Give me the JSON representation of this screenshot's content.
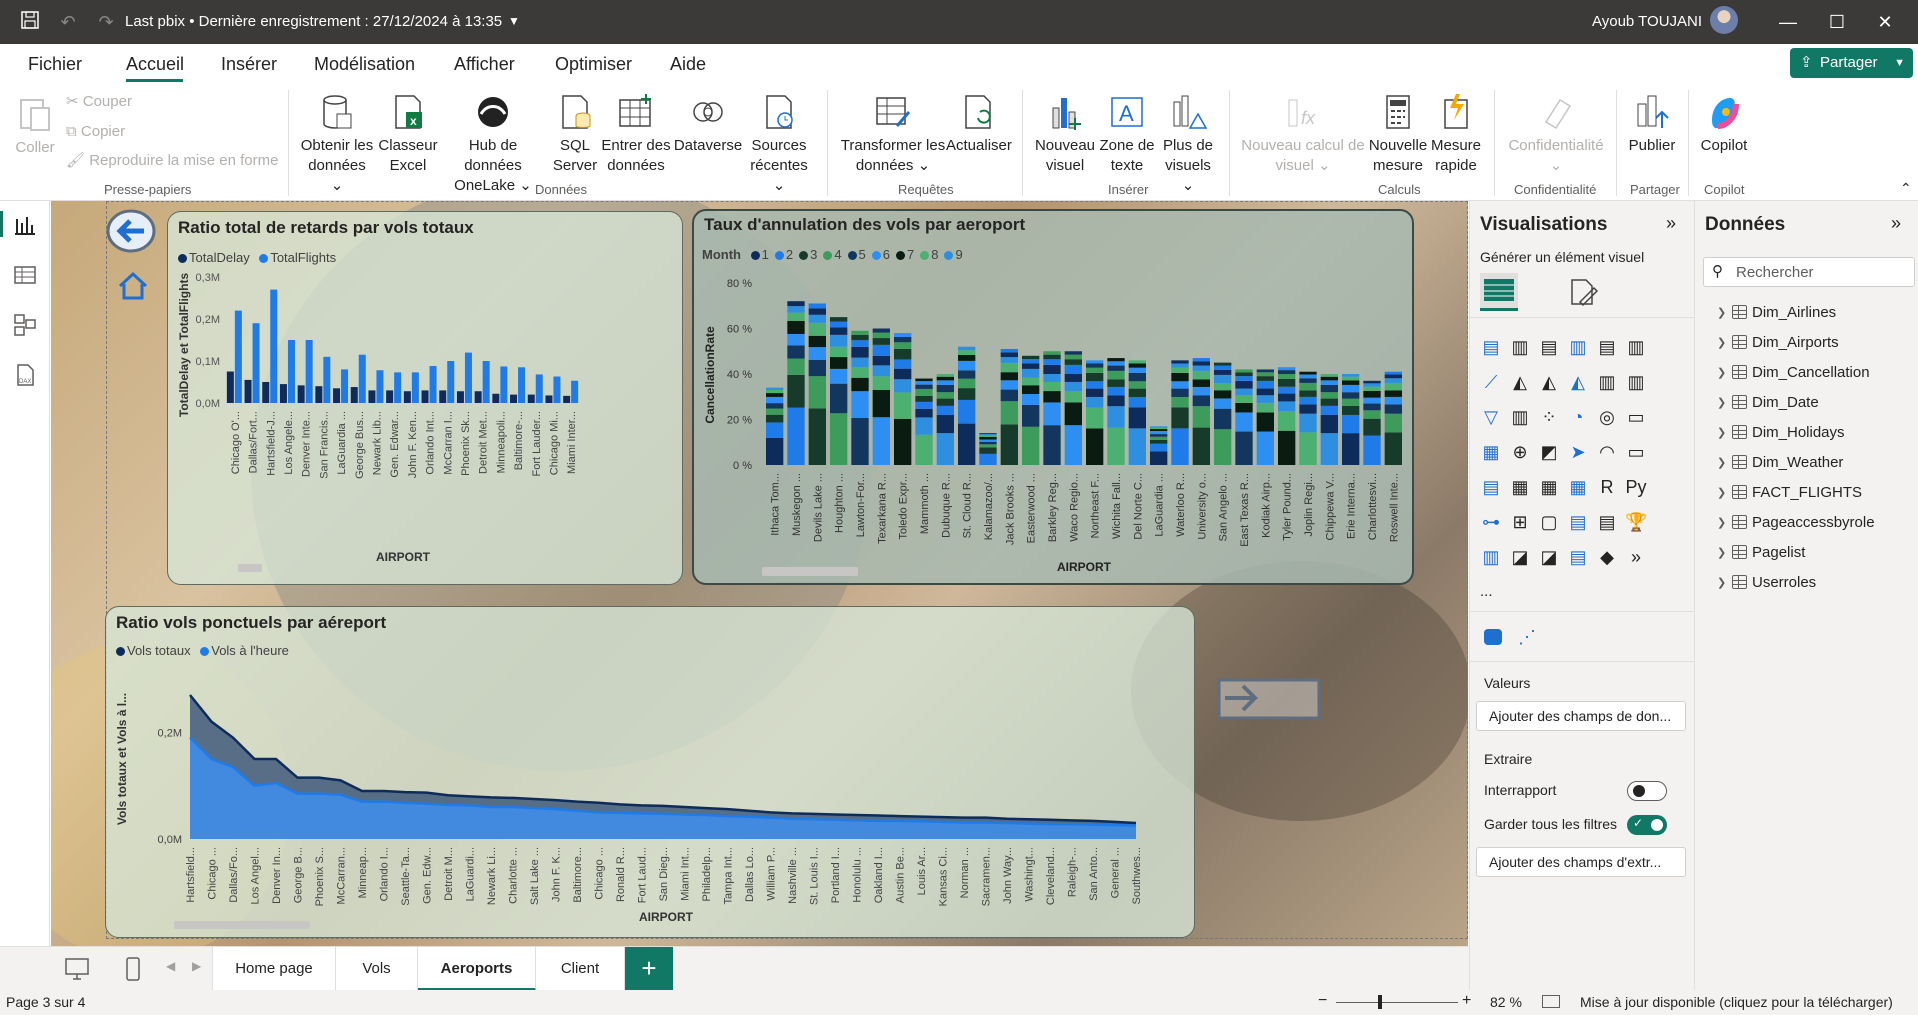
{
  "titlebar": {
    "title": "Last pbix • Dernière enregistrement : 27/12/2024 à 13:35",
    "user": "Ayoub TOUJANI"
  },
  "menu": [
    "Fichier",
    "Accueil",
    "Insérer",
    "Modélisation",
    "Afficher",
    "Optimiser",
    "Aide"
  ],
  "share_label": "Partager",
  "ribbon": {
    "clipboard": {
      "paste": "Coller",
      "cut": "Couper",
      "copy": "Copier",
      "format": "Reproduire la mise en forme",
      "group": "Presse-papiers"
    },
    "data": {
      "get": [
        "Obtenir les",
        "données"
      ],
      "excel": [
        "Classeur",
        "Excel"
      ],
      "onelake": [
        "Hub de données",
        "OneLake"
      ],
      "sql": [
        "SQL",
        "Server"
      ],
      "enter": [
        "Entrer des",
        "données"
      ],
      "dataverse": "Dataverse",
      "recent": [
        "Sources",
        "récentes"
      ],
      "group": "Données"
    },
    "queries": {
      "transform": [
        "Transformer les",
        "données"
      ],
      "refresh": "Actualiser",
      "group": "Requêtes"
    },
    "insert": {
      "visual": [
        "Nouveau",
        "visuel"
      ],
      "textbox": [
        "Zone de",
        "texte"
      ],
      "more": [
        "Plus de",
        "visuels"
      ],
      "group": "Insérer"
    },
    "calc": {
      "newcalc": [
        "Nouveau calcul de",
        "visuel"
      ],
      "measure": [
        "Nouvelle",
        "mesure"
      ],
      "quick": [
        "Mesure",
        "rapide"
      ],
      "group": "Calculs"
    },
    "sensitivity": {
      "label": "Confidentialité",
      "group": "Confidentialité"
    },
    "share": {
      "publish": "Publier",
      "group": "Partager"
    },
    "copilot": {
      "label": "Copilot",
      "group": "Copilot"
    }
  },
  "visuals": {
    "v1": {
      "title": "Ratio total de retards par vols totaux",
      "legend": [
        "TotalDelay",
        "TotalFlights"
      ],
      "ylabel": "TotalDelay et TotalFlights",
      "xlabel": "AIRPORT"
    },
    "v2": {
      "title": "Taux d'annulation des vols par aeroport",
      "legend_title": "Month",
      "legend": [
        "1",
        "2",
        "3",
        "4",
        "5",
        "6",
        "7",
        "8",
        "9"
      ],
      "ylabel": "CancellationRate",
      "xlabel": "AIRPORT"
    },
    "v3": {
      "title": "Ratio vols ponctuels par aéreport",
      "legend": [
        "Vols totaux",
        "Vols à l'heure"
      ],
      "ylabel": "Vols totaux et Vols à l...",
      "xlabel": "AIRPORT"
    }
  },
  "chart_data": [
    {
      "type": "bar",
      "title": "Ratio total de retards par vols totaux",
      "xlabel": "AIRPORT",
      "ylabel": "TotalDelay et TotalFlights",
      "yticks": [
        "0,0M",
        "0,1M",
        "0,2M",
        "0,3M"
      ],
      "ylim": [
        0,
        0.3
      ],
      "categories": [
        "Chicago O'...",
        "Dallas/Fort...",
        "Hartsfield-J...",
        "Los Angele...",
        "Denver Inte...",
        "San Francis...",
        "LaGuardia ...",
        "George Bus...",
        "Newark Lib...",
        "Gen. Edwar...",
        "John F. Ken...",
        "Orlando Int...",
        "McCarran I...",
        "Phoenix Sk...",
        "Detroit Met...",
        "Minneapoli...",
        "Baltimore-...",
        "Fort Lauder...",
        "Chicago Mi...",
        "Miami Inter..."
      ],
      "series": [
        {
          "name": "TotalDelay",
          "values": [
            0.075,
            0.055,
            0.05,
            0.045,
            0.042,
            0.04,
            0.035,
            0.038,
            0.03,
            0.03,
            0.028,
            0.03,
            0.03,
            0.028,
            0.028,
            0.022,
            0.02,
            0.02,
            0.018,
            0.017
          ]
        },
        {
          "name": "TotalFlights",
          "values": [
            0.22,
            0.19,
            0.27,
            0.15,
            0.15,
            0.11,
            0.08,
            0.115,
            0.078,
            0.073,
            0.073,
            0.088,
            0.1,
            0.12,
            0.1,
            0.087,
            0.085,
            0.068,
            0.063,
            0.053
          ]
        }
      ]
    },
    {
      "type": "bar",
      "title": "Taux d'annulation des vols par aeroport",
      "xlabel": "AIRPORT",
      "ylabel": "CancellationRate",
      "yticks": [
        "0 %",
        "20 %",
        "40 %",
        "60 %",
        "80 %"
      ],
      "ylim": [
        0,
        80
      ],
      "categories": [
        "Ithaca Tom...",
        "Muskegon ...",
        "Devils Lake ...",
        "Houghton ...",
        "Lawton-For...",
        "Texarkana R...",
        "Toledo Expr...",
        "Mammoth ...",
        "Dubuque R...",
        "St. Cloud R...",
        "Kalamazoo/...",
        "Jack Brooks ...",
        "Easterwood ...",
        "Barkley Reg...",
        "Waco Regio...",
        "Northeast F...",
        "Wichita Fall...",
        "Del Norte C...",
        "LaGuardia ...",
        "Waterloo R...",
        "University o...",
        "San Angelo ...",
        "East Texas R...",
        "Kodiak Airp...",
        "Tyler Pound...",
        "Joplin Regi...",
        "Chippewa V...",
        "Erie Interna...",
        "Charlottesvi...",
        "Roswell Inte..."
      ],
      "totals": [
        34,
        72,
        71,
        65,
        59,
        60,
        58,
        38,
        40,
        52,
        14,
        51,
        48,
        50,
        50,
        46,
        47,
        46,
        17,
        46,
        47,
        45,
        42,
        42,
        43,
        41,
        40,
        40,
        37,
        41
      ]
    },
    {
      "type": "area",
      "title": "Ratio vols ponctuels par aéreport",
      "xlabel": "AIRPORT",
      "ylabel": "Vols totaux et Vols à l...",
      "yticks": [
        "0,0M",
        "0,2M"
      ],
      "categories": [
        "Hartsfield...",
        "Chicago ...",
        "Dallas/Fo...",
        "Los Angel...",
        "Denver In...",
        "George B...",
        "Phoenix S...",
        "McCarran...",
        "Minneap...",
        "Orlando I...",
        "Seattle-Ta...",
        "Gen. Edw...",
        "Detroit M...",
        "LaGuardi...",
        "Newark Li...",
        "Charlotte ...",
        "Salt Lake ...",
        "John F. K...",
        "Baltimore...",
        "Chicago ...",
        "Ronald R...",
        "Fort Laud...",
        "San Dieg...",
        "Miami Int...",
        "Philadelp...",
        "Tampa Int...",
        "Dallas Lo...",
        "William P...",
        "Nashville ...",
        "St. Louis I...",
        "Portland I...",
        "Honolulu ...",
        "Oakland I...",
        "Austin Be...",
        "Louis Ar...",
        "Kansas Ci...",
        "Norman ...",
        "Sacramen...",
        "John Way...",
        "Washingt...",
        "Cleveland...",
        "Raleigh-...",
        "San Anto...",
        "General ...",
        "Southwes..."
      ],
      "series": [
        {
          "name": "Vols totaux",
          "values": [
            0.27,
            0.22,
            0.19,
            0.15,
            0.15,
            0.115,
            0.115,
            0.11,
            0.09,
            0.09,
            0.088,
            0.087,
            0.082,
            0.08,
            0.078,
            0.077,
            0.075,
            0.073,
            0.07,
            0.068,
            0.065,
            0.063,
            0.062,
            0.06,
            0.058,
            0.056,
            0.053,
            0.05,
            0.048,
            0.047,
            0.046,
            0.045,
            0.044,
            0.043,
            0.042,
            0.041,
            0.04,
            0.04,
            0.038,
            0.037,
            0.036,
            0.035,
            0.034,
            0.032,
            0.03
          ]
        },
        {
          "name": "Vols à l'heure",
          "values": [
            0.19,
            0.15,
            0.135,
            0.1,
            0.105,
            0.085,
            0.085,
            0.083,
            0.07,
            0.07,
            0.068,
            0.066,
            0.064,
            0.063,
            0.06,
            0.06,
            0.058,
            0.056,
            0.053,
            0.05,
            0.049,
            0.048,
            0.047,
            0.046,
            0.045,
            0.043,
            0.042,
            0.04,
            0.038,
            0.037,
            0.036,
            0.035,
            0.034,
            0.034,
            0.033,
            0.032,
            0.031,
            0.031,
            0.03,
            0.029,
            0.028,
            0.028,
            0.027,
            0.026,
            0.025
          ]
        }
      ]
    }
  ],
  "pages": [
    "Home page",
    "Vols",
    "Aeroports",
    "Client"
  ],
  "status": {
    "page": "Page 3 sur 4",
    "zoom": "82 %",
    "update": "Mise à jour disponible (cliquez pour la télécharger)"
  },
  "viz_pane": {
    "title": "Visualisations",
    "subtitle": "Générer un élément visuel",
    "values_label": "Valeurs",
    "values_placeholder": "Ajouter des champs de don...",
    "drill_label": "Extraire",
    "cross_report": "Interrapport",
    "keep_filters": "Garder tous les filtres",
    "drill_placeholder": "Ajouter des champs d'extr...",
    "more": "..."
  },
  "data_pane": {
    "title": "Données",
    "search_placeholder": "Rechercher",
    "tables": [
      "Dim_Airlines",
      "Dim_Airports",
      "Dim_Cancellation",
      "Dim_Date",
      "Dim_Holidays",
      "Dim_Weather",
      "FACT_FLIGHTS",
      "Pageaccessbyrole",
      "Pagelist",
      "Userroles"
    ]
  },
  "colors": {
    "accent": "#117865",
    "dark_navy": "#12239e",
    "blue": "#1f7be8",
    "deep": "#0e2c5b",
    "green": "#1e6e3f"
  }
}
